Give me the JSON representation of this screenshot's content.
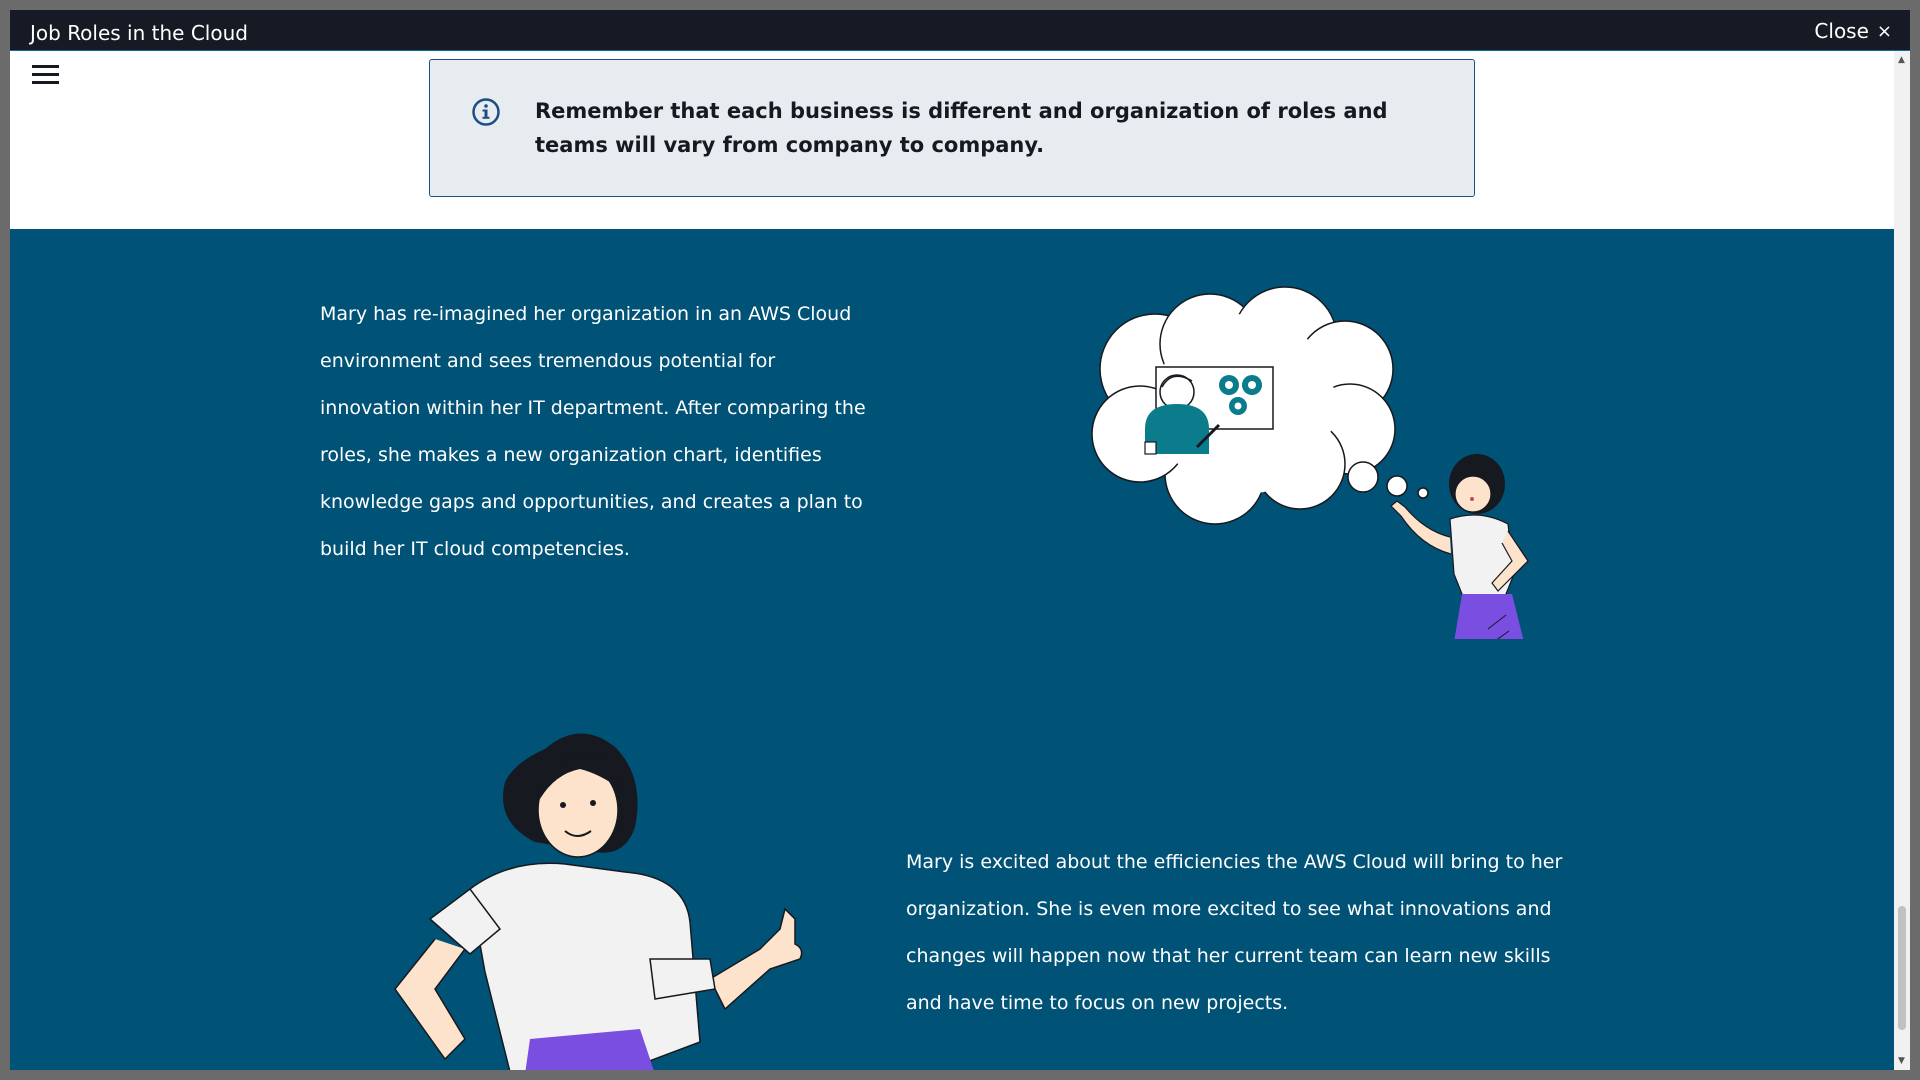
{
  "window": {
    "title": "Job Roles in the Cloud",
    "close_label": "Close",
    "close_icon": "×"
  },
  "callout": {
    "icon": "info-icon",
    "text": "Remember that each business is different and organization of roles and teams will vary from company to company."
  },
  "story": {
    "paragraph1": "Mary has re-imagined her organization in an AWS Cloud environment and sees tremendous potential for innovation within her IT department. After comparing the roles, she makes a new organization chart, identifies knowledge gaps and opportunities, and creates a plan to build her IT cloud competencies.",
    "paragraph2": "Mary is excited about the efficiencies the AWS Cloud will bring to her organization. She is even more excited to see what innovations and changes will happen now that her current team can learn new skills and have time to focus on new projects."
  },
  "colors": {
    "title_bar": "#161a24",
    "callout_bg": "#e6ecef",
    "callout_border": "#1d4e83",
    "section_bg": "#005276",
    "skirt": "#7a4ee0",
    "gear": "#0b7c8c"
  }
}
